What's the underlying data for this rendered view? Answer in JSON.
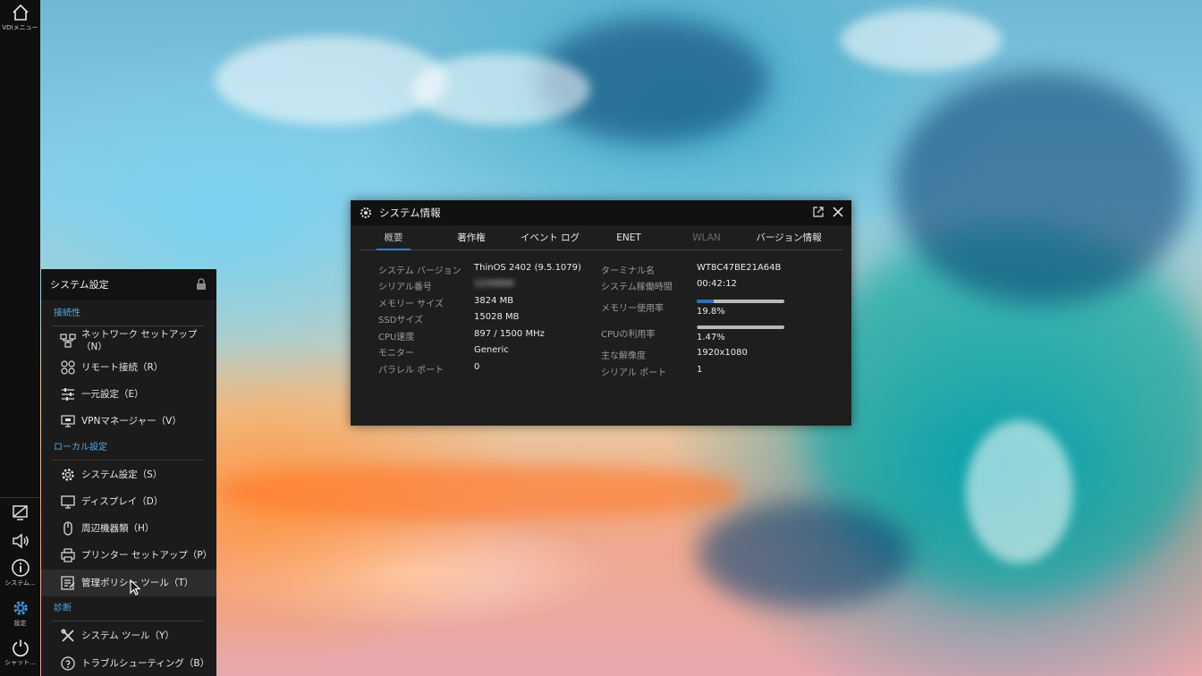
{
  "taskbar": {
    "vdi_menu_label": "VDIメニュー",
    "system_label": "システム...",
    "settings_label": "設定",
    "shutdown_label": "シャット..."
  },
  "settings_panel": {
    "title": "システム設定",
    "sections": [
      {
        "heading": "接続性",
        "items": [
          {
            "label": "ネットワーク セットアップ（N）"
          },
          {
            "label": "リモート接続（R）"
          },
          {
            "label": "一元設定（E）"
          },
          {
            "label": "VPNマネージャー（V）"
          }
        ]
      },
      {
        "heading": "ローカル設定",
        "items": [
          {
            "label": "システム設定（S）"
          },
          {
            "label": "ディスプレイ（D）"
          },
          {
            "label": "周辺機器類（H）"
          },
          {
            "label": "プリンター セットアップ（P）"
          },
          {
            "label": "管理ポリシー ツール（T）"
          }
        ]
      },
      {
        "heading": "診断",
        "items": [
          {
            "label": "システム ツール（Y）"
          },
          {
            "label": "トラブルシューティング（B）"
          }
        ]
      }
    ]
  },
  "sysinfo": {
    "title": "システム情報",
    "tabs": [
      {
        "label": "概要"
      },
      {
        "label": "著作権"
      },
      {
        "label": "イベント ログ"
      },
      {
        "label": "ENET"
      },
      {
        "label": "WLAN"
      },
      {
        "label": "バージョン情報"
      }
    ],
    "left": [
      {
        "key": "システム バージョン",
        "value": "ThinOS 2402 (9.5.1079)"
      },
      {
        "key": "シリアル番号",
        "value": "1234000"
      },
      {
        "key": "メモリー サイズ",
        "value": "3824 MB"
      },
      {
        "key": "SSDサイズ",
        "value": "15028 MB"
      },
      {
        "key": "CPU速度",
        "value": "897 / 1500 MHz"
      },
      {
        "key": "モニター",
        "value": "Generic"
      },
      {
        "key": "パラレル ポート",
        "value": "0"
      }
    ],
    "right": [
      {
        "key": "ターミナル名",
        "value": "WT8C47BE21A64B"
      },
      {
        "key": "システム稼働時間",
        "value": "00:42:12"
      },
      {
        "key": "メモリー使用率",
        "value": "19.8%",
        "fraction": 0.198
      },
      {
        "key": "CPUの利用率",
        "value": "1.47%",
        "fraction": 0.0147
      },
      {
        "key": "主な解像度",
        "value": "1920x1080"
      },
      {
        "key": "シリアル ポート",
        "value": "1"
      }
    ]
  },
  "colors": {
    "accent": "#56a8e0",
    "tab_underline": "#2f7fd0",
    "panel_bg": "#1b1b1b",
    "taskbar_bg": "#0f0f0f"
  },
  "icons": [
    "home-icon",
    "lock-icon",
    "network-setup-icon",
    "remote-connection-icon",
    "central-config-icon",
    "vpn-manager-icon",
    "system-settings-icon",
    "display-icon",
    "peripherals-icon",
    "printer-icon",
    "policy-tool-icon",
    "system-tools-icon",
    "troubleshooting-icon",
    "display-setting-icon",
    "volume-icon",
    "info-icon",
    "gear-icon",
    "power-icon",
    "wave-settings-icon",
    "external-window-icon",
    "close-icon",
    "cursor-icon"
  ]
}
